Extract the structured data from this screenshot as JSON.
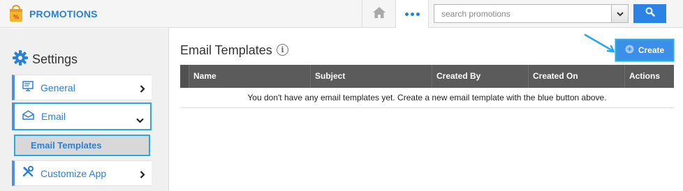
{
  "app": {
    "title": "PROMOTIONS",
    "logo_icon": "shopping-bag-icon",
    "brand_color": "#2b7fd6"
  },
  "topbar": {
    "home_icon": "home-icon",
    "more_icon": "more-dots-icon",
    "search": {
      "placeholder": "search promotions",
      "value": ""
    },
    "search_button_icon": "search-icon"
  },
  "sidebar": {
    "header": {
      "label": "Settings",
      "icon": "gear-icon"
    },
    "items": [
      {
        "label": "General",
        "icon": "monitor-icon",
        "chevron": "chevron-right-icon"
      },
      {
        "label": "Email",
        "icon": "envelope-icon",
        "chevron": "chevron-down-icon",
        "expanded": true,
        "children": [
          {
            "label": "Email Templates",
            "selected": true
          }
        ]
      },
      {
        "label": "Customize App",
        "icon": "tools-icon",
        "chevron": "chevron-right-icon"
      }
    ]
  },
  "main": {
    "title": "Email Templates",
    "info_icon_text": "i",
    "create_button": {
      "label": "Create",
      "icon": "plus-circle-icon"
    },
    "table": {
      "columns": [
        "Name",
        "Subject",
        "Created By",
        "Created On",
        "Actions"
      ],
      "rows": [],
      "empty_message": "You don't have any email templates yet. Create a new email template with the blue button above."
    }
  },
  "colors": {
    "accent": "#2b83e6",
    "highlight_border": "#25a7e8",
    "table_header_bg": "#5b5b5b"
  }
}
